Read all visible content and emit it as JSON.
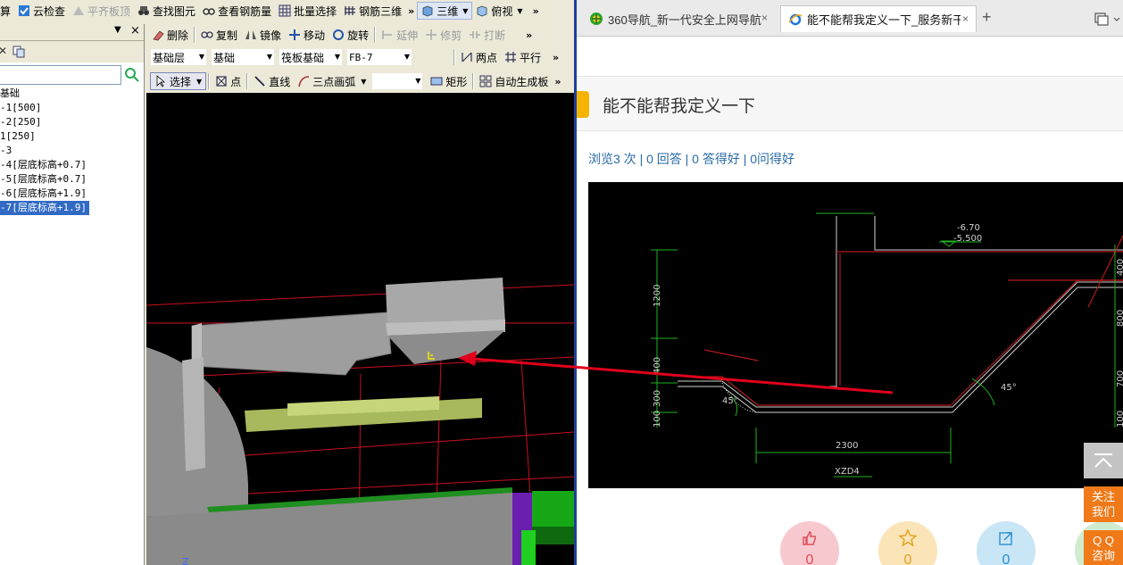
{
  "cad": {
    "toolbar1": {
      "items": [
        {
          "label": "算",
          "enabled": true
        },
        {
          "label": "云检查",
          "enabled": true
        },
        {
          "label": "平齐板顶",
          "enabled": false
        },
        {
          "label": "查找图元",
          "enabled": true
        },
        {
          "label": "查看钢筋量",
          "enabled": true
        },
        {
          "label": "批量选择",
          "enabled": true
        },
        {
          "label": "钢筋三维",
          "enabled": true
        },
        {
          "label": "三维",
          "enabled": true
        },
        {
          "label": "俯视",
          "enabled": true
        }
      ],
      "more": "»"
    },
    "toolbar2": {
      "items": [
        {
          "label": "删除",
          "enabled": true
        },
        {
          "label": "复制",
          "enabled": true
        },
        {
          "label": "镜像",
          "enabled": true
        },
        {
          "label": "移动",
          "enabled": true
        },
        {
          "label": "旋转",
          "enabled": true
        },
        {
          "label": "延伸",
          "enabled": false
        },
        {
          "label": "修剪",
          "enabled": false
        },
        {
          "label": "打断",
          "enabled": false
        }
      ],
      "more": "»"
    },
    "toolbar3": {
      "combos": [
        "基础层",
        "基础",
        "筏板基础",
        "FB-7"
      ],
      "items": [
        {
          "label": "两点",
          "enabled": true
        },
        {
          "label": "平行",
          "enabled": true
        }
      ],
      "more": "»"
    },
    "toolbar4": {
      "items": [
        {
          "label": "选择",
          "enabled": true
        },
        {
          "label": "点",
          "enabled": true
        },
        {
          "label": "直线",
          "enabled": true
        },
        {
          "label": "三点画弧",
          "enabled": true
        },
        {
          "label": "矩形",
          "enabled": true
        },
        {
          "label": "自动生成板",
          "enabled": true
        }
      ],
      "more": "»"
    },
    "panel": {
      "pin": "▼",
      "close": "×",
      "tree": [
        "基础",
        "-1[500]",
        "-2[250]",
        "1[250]",
        "-3",
        "-4[层底标高+0.7]",
        "-5[层底标高+0.7]",
        "-6[层底标高+1.9]",
        "-7[层底标高+1.9]"
      ],
      "selected_index": 8
    },
    "axis_label": "Z"
  },
  "browser": {
    "tabs": [
      {
        "title": "360导航_新一代安全上网导航",
        "close": "×"
      },
      {
        "title": "能不能帮我定义一下_服务新干线",
        "close": "×"
      }
    ],
    "new_tab": "+",
    "question_title": "能不能帮我定义一下",
    "stats": "浏览3 次 | 0 回答 | 0 答得好 | 0问得好",
    "drawing": {
      "labels": [
        "-6.70",
        "-5.500",
        "1200",
        "400",
        "300",
        "100",
        "400",
        "800",
        "700",
        "100",
        "2300",
        "XZD4",
        "45°",
        "45°"
      ]
    },
    "actions": [
      {
        "icon": "thumbs-up-icon",
        "count": "0",
        "color": "#f7c9cf"
      },
      {
        "icon": "star-icon",
        "count": "0",
        "color": "#fbe4b8"
      },
      {
        "icon": "share-icon",
        "count": "0",
        "color": "#c9e6f7"
      }
    ],
    "side": {
      "back_top": "top",
      "follow": [
        "关注",
        "我们"
      ],
      "qq": [
        "Q Q",
        "咨询"
      ]
    }
  },
  "colors": {
    "selection": "#316ac5",
    "link": "#2a6aa6",
    "orange": "#f07a1a",
    "arrow": "#e0001c"
  }
}
